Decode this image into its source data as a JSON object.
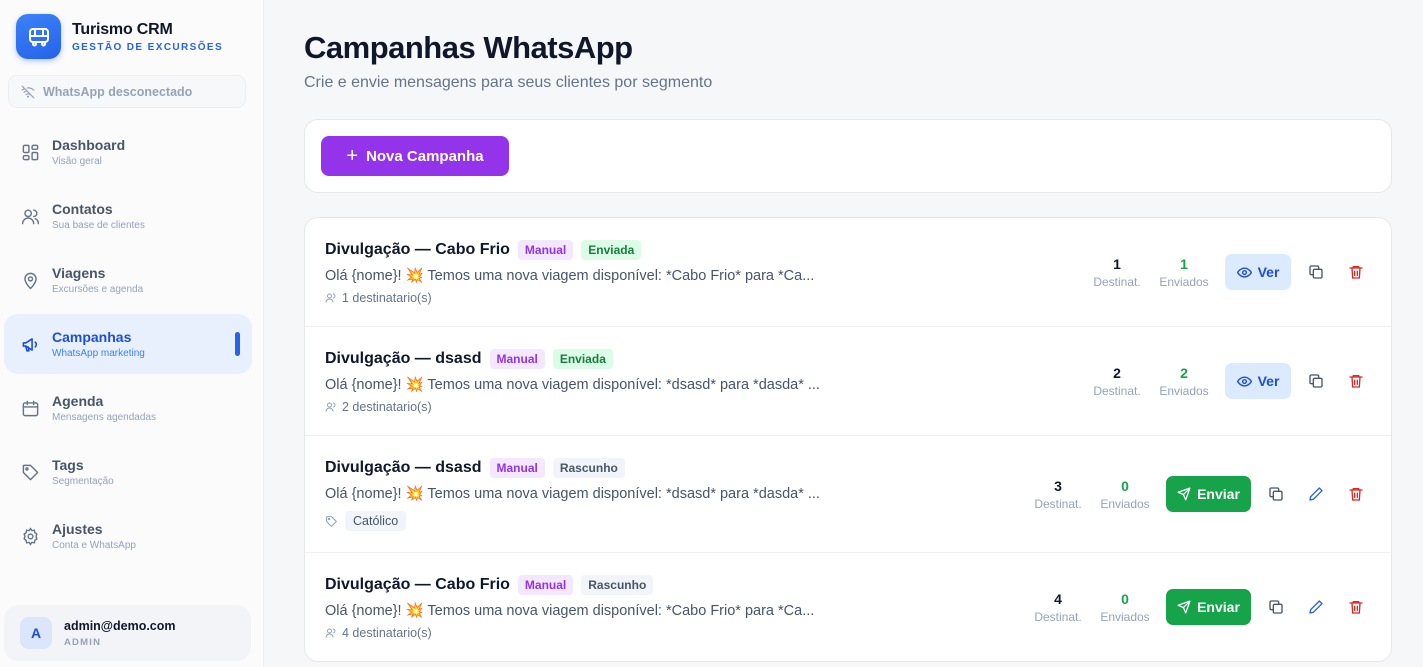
{
  "brand": {
    "title": "Turismo CRM",
    "subtitle": "GESTÃO DE EXCURSÕES"
  },
  "whatsapp_status": "WhatsApp desconectado",
  "nav": [
    {
      "label": "Dashboard",
      "sub": "Visão geral",
      "icon": "grid-icon"
    },
    {
      "label": "Contatos",
      "sub": "Sua base de clientes",
      "icon": "users-icon"
    },
    {
      "label": "Viagens",
      "sub": "Excursões e agenda",
      "icon": "map-pin-icon"
    },
    {
      "label": "Campanhas",
      "sub": "WhatsApp marketing",
      "icon": "megaphone-icon",
      "active": true
    },
    {
      "label": "Agenda",
      "sub": "Mensagens agendadas",
      "icon": "calendar-icon"
    },
    {
      "label": "Tags",
      "sub": "Segmentação",
      "icon": "tag-icon"
    },
    {
      "label": "Ajustes",
      "sub": "Conta e WhatsApp",
      "icon": "gear-icon"
    }
  ],
  "user": {
    "initial": "A",
    "email": "admin@demo.com",
    "role": "ADMIN"
  },
  "page": {
    "title": "Campanhas WhatsApp",
    "subtitle": "Crie e envie mensagens para seus clientes por segmento"
  },
  "toolbar": {
    "new_label": "Nova Campanha"
  },
  "labels": {
    "recipients": "Destinat.",
    "sent": "Enviados",
    "view": "Ver",
    "send": "Enviar"
  },
  "campaigns": [
    {
      "title": "Divulgação — Cabo Frio",
      "type": "Manual",
      "status": "Enviada",
      "message": "Olá {nome}! 💥 Temos uma nova viagem disponível: *Cabo Frio* para *Ca...",
      "meta": "1 destinatario(s)",
      "recipients": "1",
      "sent": "1"
    },
    {
      "title": "Divulgação — dsasd",
      "type": "Manual",
      "status": "Enviada",
      "message": "Olá {nome}! 💥 Temos uma nova viagem disponível: *dsasd* para *dasda* ...",
      "meta": "2 destinatario(s)",
      "recipients": "2",
      "sent": "2"
    },
    {
      "title": "Divulgação — dsasd",
      "type": "Manual",
      "status": "Rascunho",
      "message": "Olá {nome}! 💥 Temos uma nova viagem disponível: *dsasd* para *dasda* ...",
      "tag": "Católico",
      "recipients": "3",
      "sent": "0"
    },
    {
      "title": "Divulgação — Cabo Frio",
      "type": "Manual",
      "status": "Rascunho",
      "message": "Olá {nome}! 💥 Temos uma nova viagem disponível: *Cabo Frio* para *Ca...",
      "meta": "4 destinatario(s)",
      "recipients": "4",
      "sent": "0"
    }
  ],
  "colors": {
    "accent": "#2563eb",
    "primary_button": "#9333ea",
    "send_button": "#16a34a",
    "delete": "#dc2626"
  }
}
